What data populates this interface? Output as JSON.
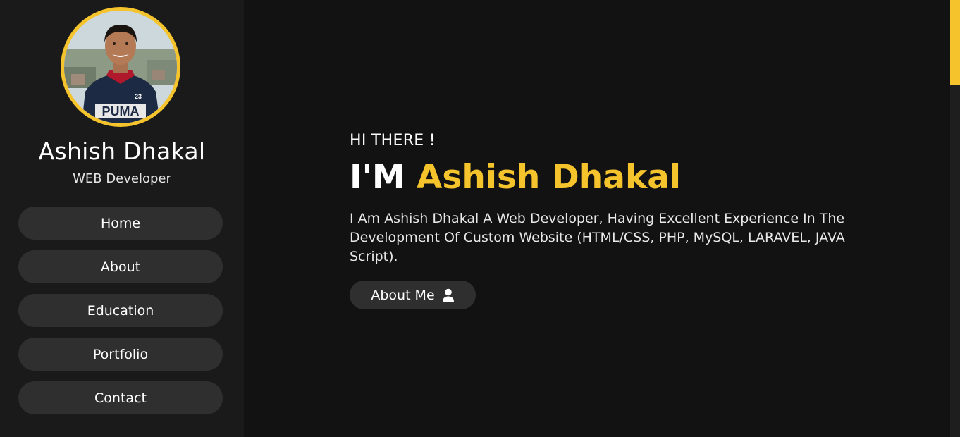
{
  "profile": {
    "name": "Ashish Dhakal",
    "role": "WEB Developer",
    "photo_shirt_text": "PUMA",
    "photo_shirt_number": "23"
  },
  "nav": {
    "items": [
      {
        "label": "Home"
      },
      {
        "label": "About"
      },
      {
        "label": "Education"
      },
      {
        "label": "Portfolio"
      },
      {
        "label": "Contact"
      }
    ]
  },
  "hero": {
    "greeting": "HI THERE !",
    "prefix": "I'M",
    "name": "Ashish Dhakal",
    "intro": "I Am Ashish Dhakal A Web Developer, Having Excellent Experience In The Development Of Custom Website (HTML/CSS, PHP, MySQL, LARAVEL, JAVA Script).",
    "button_label": "About Me",
    "button_icon": "user-icon"
  },
  "colors": {
    "accent": "#f5c32c",
    "background": "#121212",
    "sidebar": "#1a1a1a",
    "button": "#2f2f2f"
  }
}
